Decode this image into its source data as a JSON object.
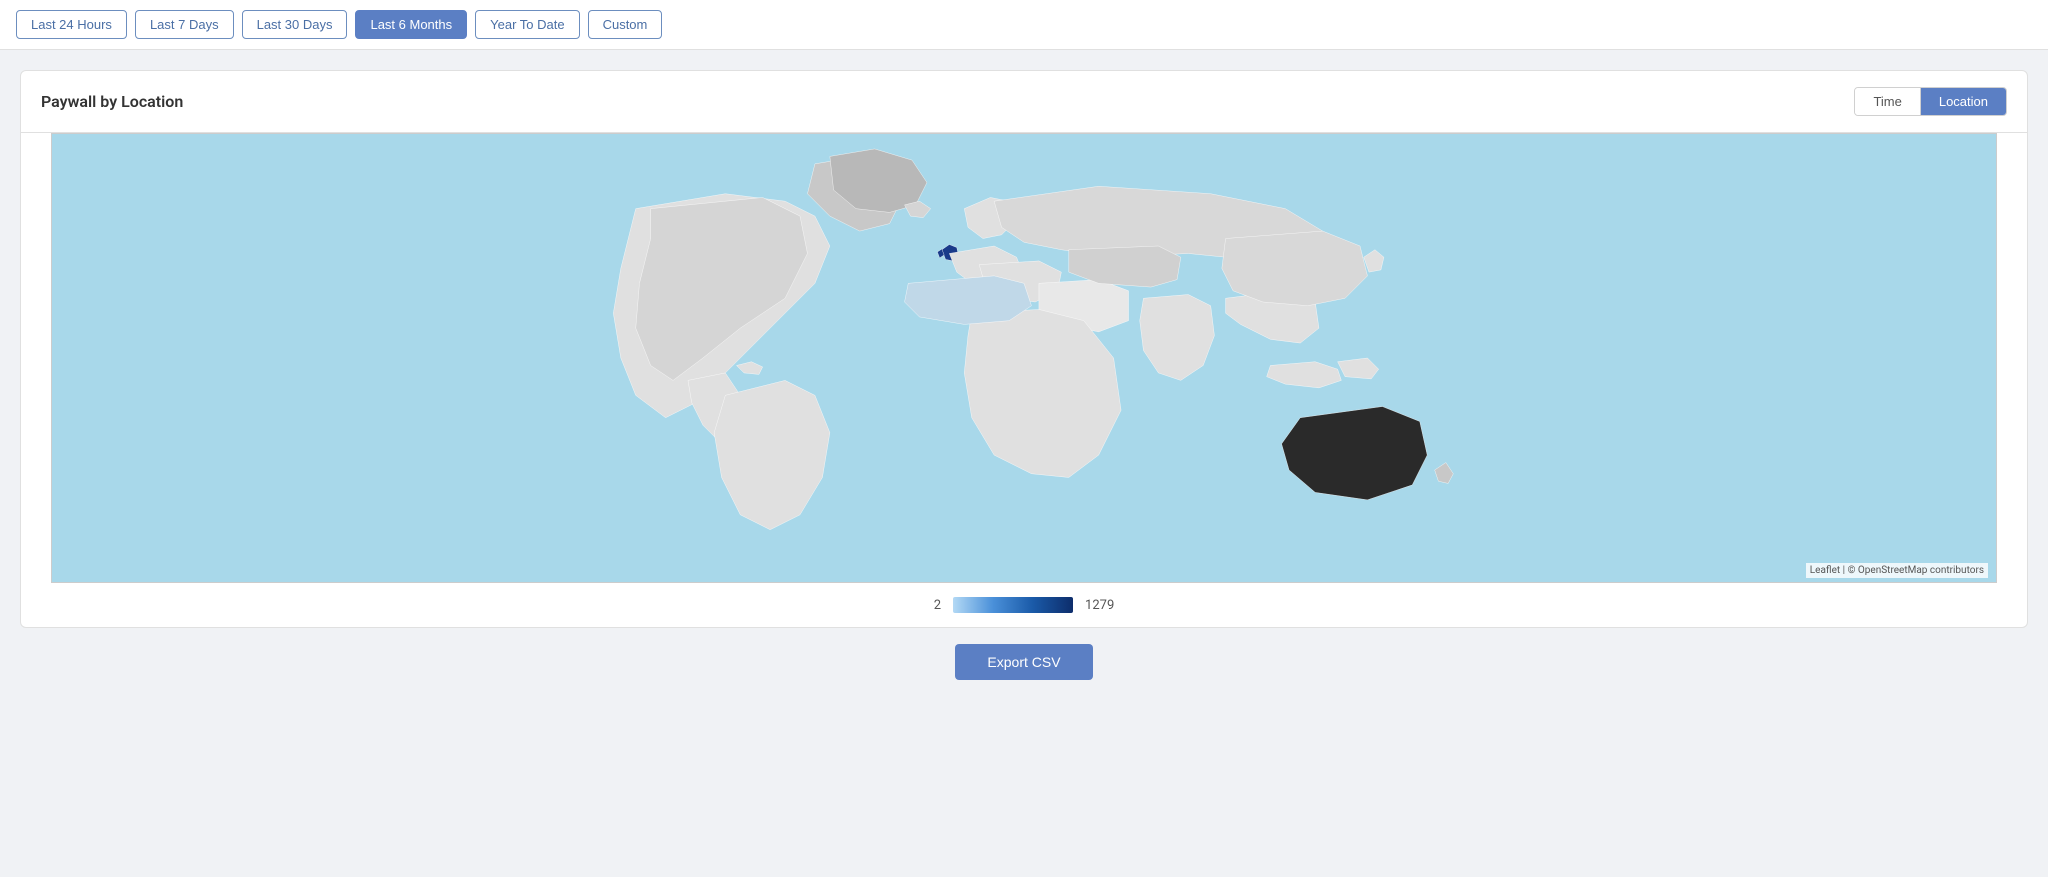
{
  "topBar": {
    "buttons": [
      {
        "label": "Last 24 Hours",
        "active": false
      },
      {
        "label": "Last 7 Days",
        "active": false
      },
      {
        "label": "Last 30 Days",
        "active": false
      },
      {
        "label": "Last 6 Months",
        "active": true
      },
      {
        "label": "Year To Date",
        "active": false
      },
      {
        "label": "Custom",
        "active": false
      }
    ]
  },
  "card": {
    "title": "Paywall by Location",
    "viewToggle": {
      "time_label": "Time",
      "location_label": "Location"
    }
  },
  "legend": {
    "min_value": "2",
    "max_value": "1279"
  },
  "exportButton": {
    "label": "Export CSV"
  },
  "attribution": {
    "leaflet_text": "Leaflet",
    "osm_text": "© OpenStreetMap contributors"
  }
}
